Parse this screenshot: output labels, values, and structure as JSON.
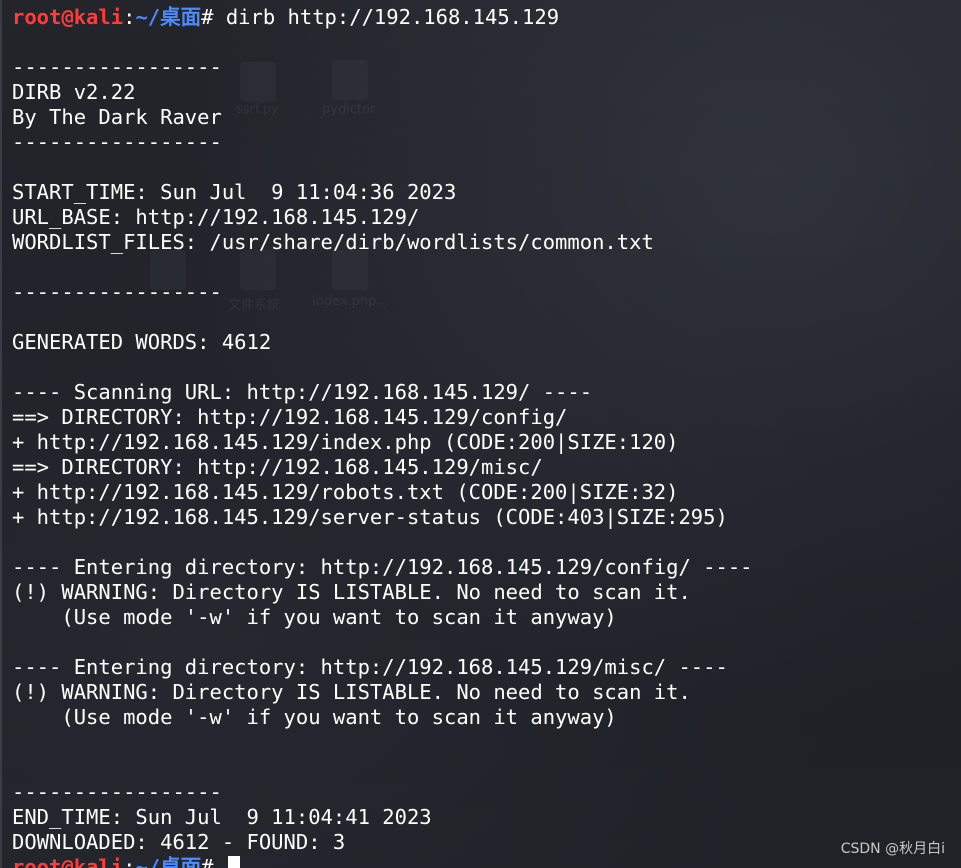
{
  "prompt": {
    "user_host": "root@kali",
    "separator": ":",
    "path": "~/桌面",
    "symbol": "# "
  },
  "command": "dirb http://192.168.145.129",
  "output_lines": [
    "",
    "-----------------",
    "DIRB v2.22",
    "By The Dark Raver",
    "-----------------",
    "",
    "START_TIME: Sun Jul  9 11:04:36 2023",
    "URL_BASE: http://192.168.145.129/",
    "WORDLIST_FILES: /usr/share/dirb/wordlists/common.txt",
    "",
    "-----------------",
    "",
    "GENERATED WORDS: 4612",
    "",
    "---- Scanning URL: http://192.168.145.129/ ----",
    "==> DIRECTORY: http://192.168.145.129/config/",
    "+ http://192.168.145.129/index.php (CODE:200|SIZE:120)",
    "==> DIRECTORY: http://192.168.145.129/misc/",
    "+ http://192.168.145.129/robots.txt (CODE:200|SIZE:32)",
    "+ http://192.168.145.129/server-status (CODE:403|SIZE:295)",
    "",
    "---- Entering directory: http://192.168.145.129/config/ ----",
    "(!) WARNING: Directory IS LISTABLE. No need to scan it.",
    "    (Use mode '-w' if you want to scan it anyway)",
    "",
    "---- Entering directory: http://192.168.145.129/misc/ ----",
    "(!) WARNING: Directory IS LISTABLE. No need to scan it.",
    "    (Use mode '-w' if you want to scan it anyway)",
    "",
    "",
    "-----------------",
    "END_TIME: Sun Jul  9 11:04:41 2023",
    "DOWNLOADED: 4612 - FOUND: 3"
  ],
  "background_labels": [
    "ssrf.py",
    "pydictor",
    "文件系统",
    "index.php..."
  ],
  "watermark": "CSDN @秋月白i",
  "colors": {
    "prompt_user": "#ff3b3b",
    "prompt_path": "#4b8bff",
    "text": "#ffffff",
    "background": "#1c1e24"
  }
}
